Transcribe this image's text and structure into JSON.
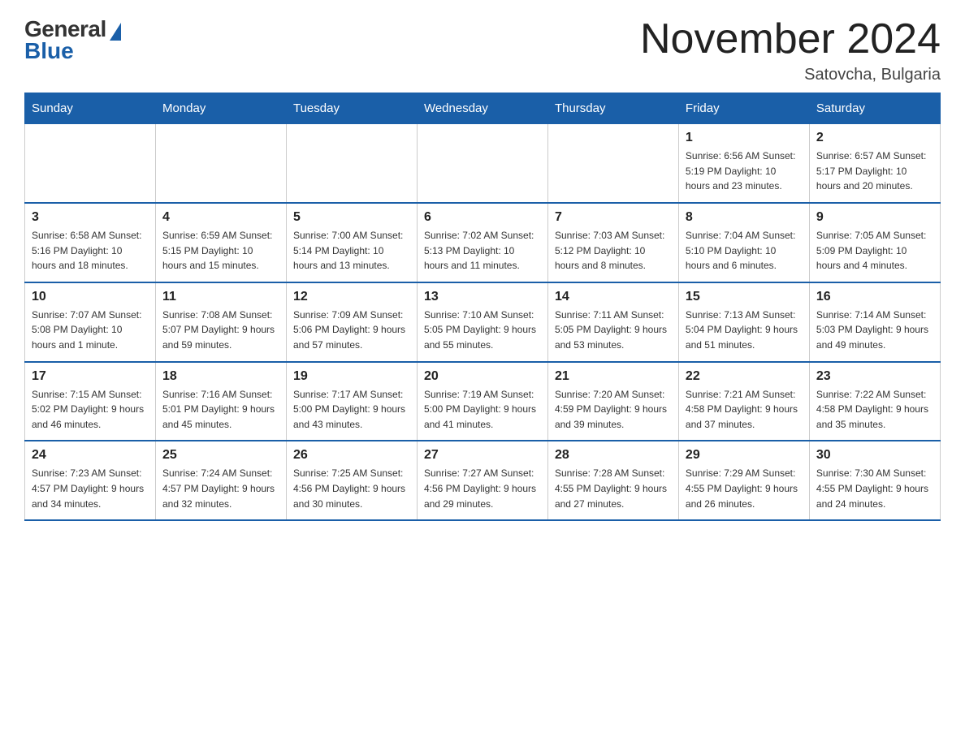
{
  "logo": {
    "general": "General",
    "blue": "Blue"
  },
  "header": {
    "month_title": "November 2024",
    "subtitle": "Satovcha, Bulgaria"
  },
  "weekdays": [
    "Sunday",
    "Monday",
    "Tuesday",
    "Wednesday",
    "Thursday",
    "Friday",
    "Saturday"
  ],
  "weeks": [
    [
      {
        "day": "",
        "info": "",
        "empty": true
      },
      {
        "day": "",
        "info": "",
        "empty": true
      },
      {
        "day": "",
        "info": "",
        "empty": true
      },
      {
        "day": "",
        "info": "",
        "empty": true
      },
      {
        "day": "",
        "info": "",
        "empty": true
      },
      {
        "day": "1",
        "info": "Sunrise: 6:56 AM\nSunset: 5:19 PM\nDaylight: 10 hours and 23 minutes.",
        "empty": false
      },
      {
        "day": "2",
        "info": "Sunrise: 6:57 AM\nSunset: 5:17 PM\nDaylight: 10 hours and 20 minutes.",
        "empty": false
      }
    ],
    [
      {
        "day": "3",
        "info": "Sunrise: 6:58 AM\nSunset: 5:16 PM\nDaylight: 10 hours and 18 minutes.",
        "empty": false
      },
      {
        "day": "4",
        "info": "Sunrise: 6:59 AM\nSunset: 5:15 PM\nDaylight: 10 hours and 15 minutes.",
        "empty": false
      },
      {
        "day": "5",
        "info": "Sunrise: 7:00 AM\nSunset: 5:14 PM\nDaylight: 10 hours and 13 minutes.",
        "empty": false
      },
      {
        "day": "6",
        "info": "Sunrise: 7:02 AM\nSunset: 5:13 PM\nDaylight: 10 hours and 11 minutes.",
        "empty": false
      },
      {
        "day": "7",
        "info": "Sunrise: 7:03 AM\nSunset: 5:12 PM\nDaylight: 10 hours and 8 minutes.",
        "empty": false
      },
      {
        "day": "8",
        "info": "Sunrise: 7:04 AM\nSunset: 5:10 PM\nDaylight: 10 hours and 6 minutes.",
        "empty": false
      },
      {
        "day": "9",
        "info": "Sunrise: 7:05 AM\nSunset: 5:09 PM\nDaylight: 10 hours and 4 minutes.",
        "empty": false
      }
    ],
    [
      {
        "day": "10",
        "info": "Sunrise: 7:07 AM\nSunset: 5:08 PM\nDaylight: 10 hours and 1 minute.",
        "empty": false
      },
      {
        "day": "11",
        "info": "Sunrise: 7:08 AM\nSunset: 5:07 PM\nDaylight: 9 hours and 59 minutes.",
        "empty": false
      },
      {
        "day": "12",
        "info": "Sunrise: 7:09 AM\nSunset: 5:06 PM\nDaylight: 9 hours and 57 minutes.",
        "empty": false
      },
      {
        "day": "13",
        "info": "Sunrise: 7:10 AM\nSunset: 5:05 PM\nDaylight: 9 hours and 55 minutes.",
        "empty": false
      },
      {
        "day": "14",
        "info": "Sunrise: 7:11 AM\nSunset: 5:05 PM\nDaylight: 9 hours and 53 minutes.",
        "empty": false
      },
      {
        "day": "15",
        "info": "Sunrise: 7:13 AM\nSunset: 5:04 PM\nDaylight: 9 hours and 51 minutes.",
        "empty": false
      },
      {
        "day": "16",
        "info": "Sunrise: 7:14 AM\nSunset: 5:03 PM\nDaylight: 9 hours and 49 minutes.",
        "empty": false
      }
    ],
    [
      {
        "day": "17",
        "info": "Sunrise: 7:15 AM\nSunset: 5:02 PM\nDaylight: 9 hours and 46 minutes.",
        "empty": false
      },
      {
        "day": "18",
        "info": "Sunrise: 7:16 AM\nSunset: 5:01 PM\nDaylight: 9 hours and 45 minutes.",
        "empty": false
      },
      {
        "day": "19",
        "info": "Sunrise: 7:17 AM\nSunset: 5:00 PM\nDaylight: 9 hours and 43 minutes.",
        "empty": false
      },
      {
        "day": "20",
        "info": "Sunrise: 7:19 AM\nSunset: 5:00 PM\nDaylight: 9 hours and 41 minutes.",
        "empty": false
      },
      {
        "day": "21",
        "info": "Sunrise: 7:20 AM\nSunset: 4:59 PM\nDaylight: 9 hours and 39 minutes.",
        "empty": false
      },
      {
        "day": "22",
        "info": "Sunrise: 7:21 AM\nSunset: 4:58 PM\nDaylight: 9 hours and 37 minutes.",
        "empty": false
      },
      {
        "day": "23",
        "info": "Sunrise: 7:22 AM\nSunset: 4:58 PM\nDaylight: 9 hours and 35 minutes.",
        "empty": false
      }
    ],
    [
      {
        "day": "24",
        "info": "Sunrise: 7:23 AM\nSunset: 4:57 PM\nDaylight: 9 hours and 34 minutes.",
        "empty": false
      },
      {
        "day": "25",
        "info": "Sunrise: 7:24 AM\nSunset: 4:57 PM\nDaylight: 9 hours and 32 minutes.",
        "empty": false
      },
      {
        "day": "26",
        "info": "Sunrise: 7:25 AM\nSunset: 4:56 PM\nDaylight: 9 hours and 30 minutes.",
        "empty": false
      },
      {
        "day": "27",
        "info": "Sunrise: 7:27 AM\nSunset: 4:56 PM\nDaylight: 9 hours and 29 minutes.",
        "empty": false
      },
      {
        "day": "28",
        "info": "Sunrise: 7:28 AM\nSunset: 4:55 PM\nDaylight: 9 hours and 27 minutes.",
        "empty": false
      },
      {
        "day": "29",
        "info": "Sunrise: 7:29 AM\nSunset: 4:55 PM\nDaylight: 9 hours and 26 minutes.",
        "empty": false
      },
      {
        "day": "30",
        "info": "Sunrise: 7:30 AM\nSunset: 4:55 PM\nDaylight: 9 hours and 24 minutes.",
        "empty": false
      }
    ]
  ]
}
